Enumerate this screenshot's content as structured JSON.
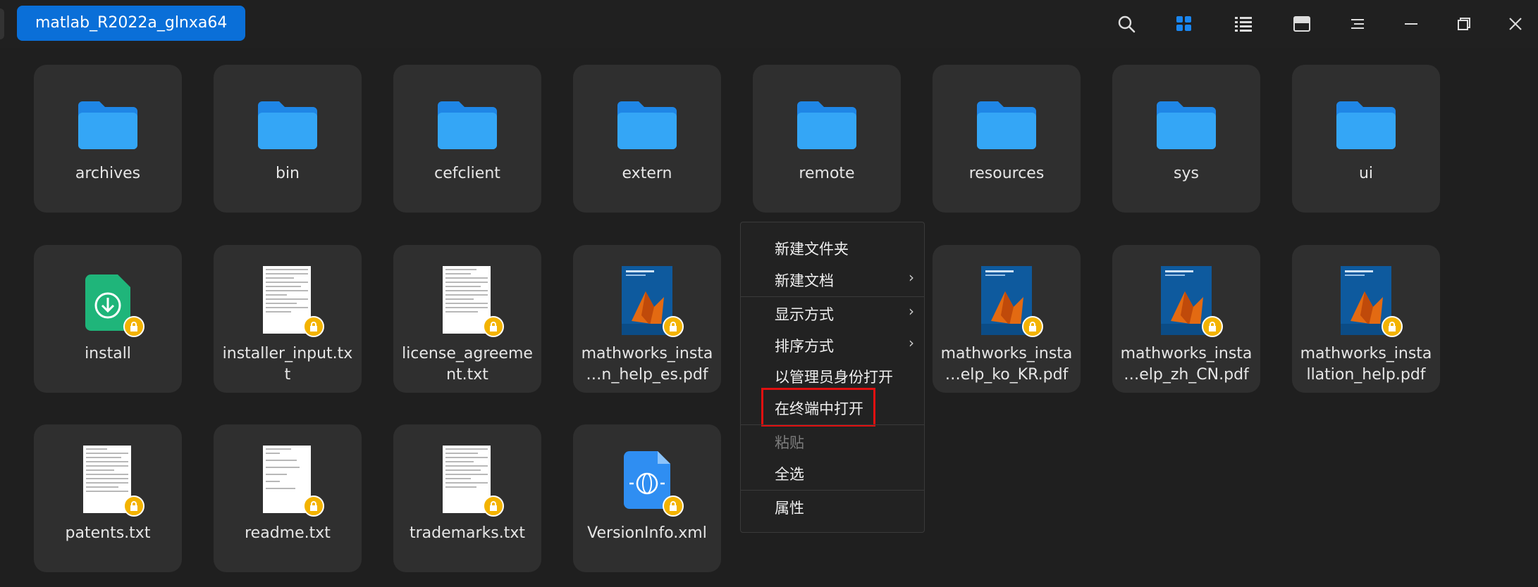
{
  "titlebar": {
    "breadcrumb": "matlab_R2022a_glnxa64",
    "icons": [
      "search-icon",
      "icon-view-icon",
      "list-view-icon",
      "tree-view-icon",
      "menu-icon",
      "minimize-icon",
      "maximize-icon",
      "close-icon"
    ]
  },
  "files": [
    {
      "label": "archives",
      "type": "folder"
    },
    {
      "label": "bin",
      "type": "folder"
    },
    {
      "label": "cefclient",
      "type": "folder"
    },
    {
      "label": "extern",
      "type": "folder"
    },
    {
      "label": "remote",
      "type": "folder"
    },
    {
      "label": "resources",
      "type": "folder"
    },
    {
      "label": "sys",
      "type": "folder"
    },
    {
      "label": "ui",
      "type": "folder"
    },
    {
      "label": "install",
      "type": "installer"
    },
    {
      "label": "installer_input.tx\nt",
      "type": "text"
    },
    {
      "label": "license_agreeme\nnt.txt",
      "type": "text"
    },
    {
      "label": "mathworks_insta\n…n_help_es.pdf",
      "type": "pdf"
    },
    {
      "label": "mathworks_insta\n…elp_ko_KR.pdf",
      "type": "pdf"
    },
    {
      "label": "mathworks_insta\n…elp_zh_CN.pdf",
      "type": "pdf"
    },
    {
      "label": "mathworks_insta\nllation_help.pdf",
      "type": "pdf"
    },
    {
      "label": "patents.txt",
      "type": "text"
    },
    {
      "label": "readme.txt",
      "type": "text"
    },
    {
      "label": "trademarks.txt",
      "type": "text"
    },
    {
      "label": "VersionInfo.xml",
      "type": "xml"
    }
  ],
  "context_menu": {
    "items": [
      {
        "label": "新建文件夹"
      },
      {
        "label": "新建文档",
        "submenu": true
      },
      {
        "label": "显示方式",
        "submenu": true
      },
      {
        "label": "排序方式",
        "submenu": true
      },
      {
        "label": "以管理员身份打开"
      },
      {
        "label": "在终端中打开",
        "highlighted": true
      },
      {
        "label": "粘贴",
        "disabled": true
      },
      {
        "label": "全选"
      },
      {
        "label": "属性"
      }
    ]
  },
  "colors": {
    "accent": "#0a6fd8",
    "folder": "#2b9cf0",
    "lock": "#f3b300",
    "highlight": "#e01010"
  }
}
